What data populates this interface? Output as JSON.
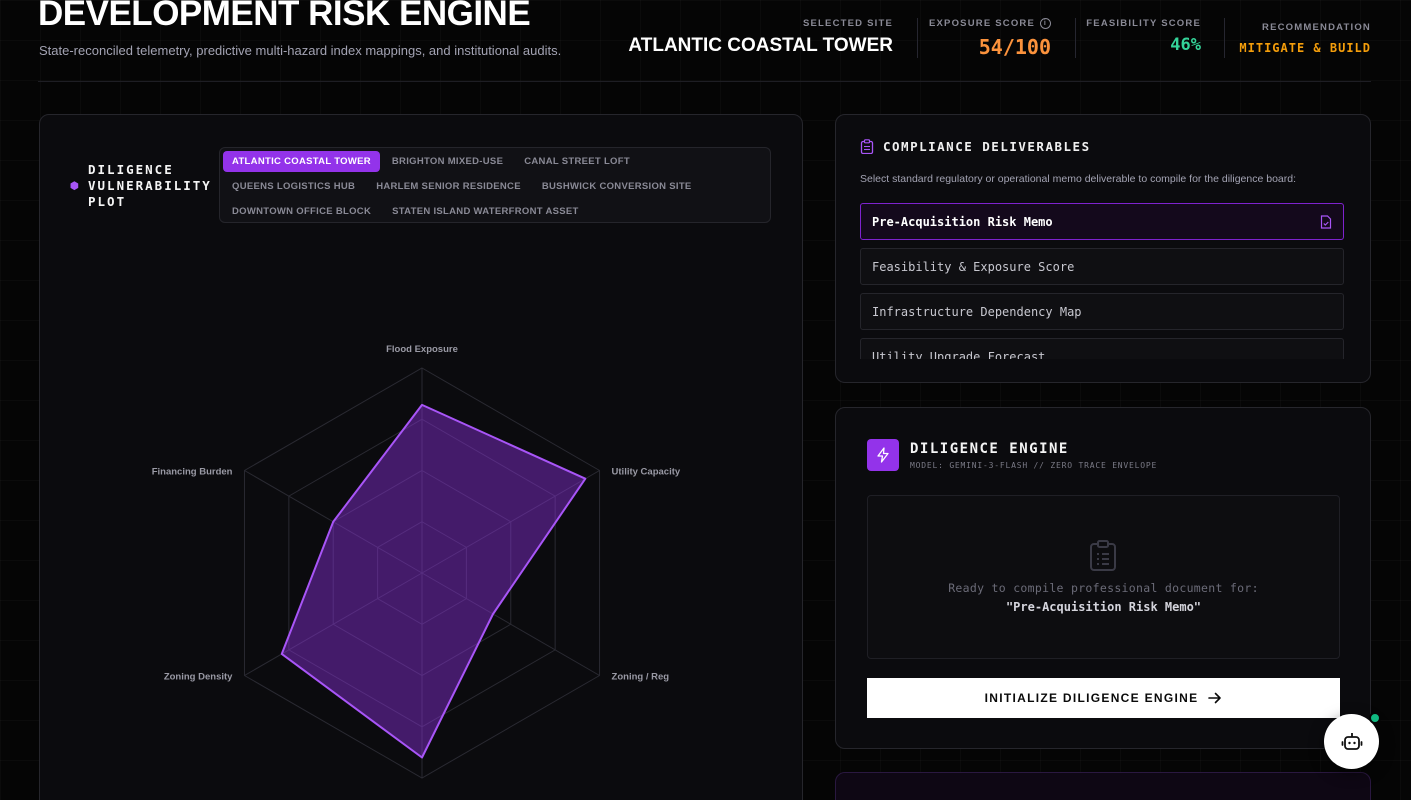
{
  "header": {
    "title": "DEVELOPMENT RISK ENGINE",
    "subtitle": "State-reconciled telemetry, predictive multi-hazard index mappings, and institutional audits.",
    "selected_site_label": "SELECTED SITE",
    "selected_site_value": "ATLANTIC COASTAL TOWER",
    "exposure_label": "EXPOSURE SCORE",
    "exposure_value": "54/100",
    "feasibility_label": "FEASIBILITY SCORE",
    "feasibility_value": "46%",
    "recommendation_label": "RECOMMENDATION",
    "recommendation_value": "MITIGATE & BUILD",
    "colors": {
      "exposure": "#fb923c",
      "feasibility": "#34d399",
      "recommendation": "#f59e0b",
      "accent": "#9333ea"
    }
  },
  "plot": {
    "title_line1": "DILIGENCE",
    "title_line2": "VULNERABILITY",
    "title_line3": "PLOT",
    "title_icon": "cube-icon",
    "sites": [
      {
        "label": "ATLANTIC COASTAL TOWER",
        "active": true
      },
      {
        "label": "BRIGHTON MIXED-USE",
        "active": false
      },
      {
        "label": "CANAL STREET LOFT",
        "active": false
      },
      {
        "label": "QUEENS LOGISTICS HUB",
        "active": false
      },
      {
        "label": "HARLEM SENIOR RESIDENCE",
        "active": false
      },
      {
        "label": "BUSHWICK CONVERSION SITE",
        "active": false
      },
      {
        "label": "DOWNTOWN OFFICE BLOCK",
        "active": false
      },
      {
        "label": "STATEN ISLAND WATERFRONT ASSET",
        "active": false
      }
    ]
  },
  "chart_data": {
    "type": "radar",
    "axes": [
      "Flood Exposure",
      "Utility Capacity",
      "Zoning / Reg",
      "",
      "Zoning Density",
      "Financing Burden"
    ],
    "values": [
      82,
      92,
      40,
      90,
      79,
      50
    ],
    "range": [
      0,
      100
    ],
    "rings": 4,
    "color": "#a855f7"
  },
  "compliance": {
    "title": "COMPLIANCE DELIVERABLES",
    "description": "Select standard regulatory or operational memo deliverable to compile for the diligence board:",
    "items": [
      {
        "label": "Pre-Acquisition Risk Memo",
        "active": true
      },
      {
        "label": "Feasibility & Exposure Score",
        "active": false
      },
      {
        "label": "Infrastructure Dependency Map",
        "active": false
      },
      {
        "label": "Utility Upgrade Forecast",
        "active": false
      }
    ]
  },
  "engine": {
    "title": "DILIGENCE ENGINE",
    "model": "MODEL: GEMINI-3-FLASH // ZERO TRACE ENVELOPE",
    "ready_text": "Ready to compile professional document for:",
    "ready_doc": "\"Pre-Acquisition Risk Memo\"",
    "button_label": "INITIALIZE DILIGENCE ENGINE"
  }
}
